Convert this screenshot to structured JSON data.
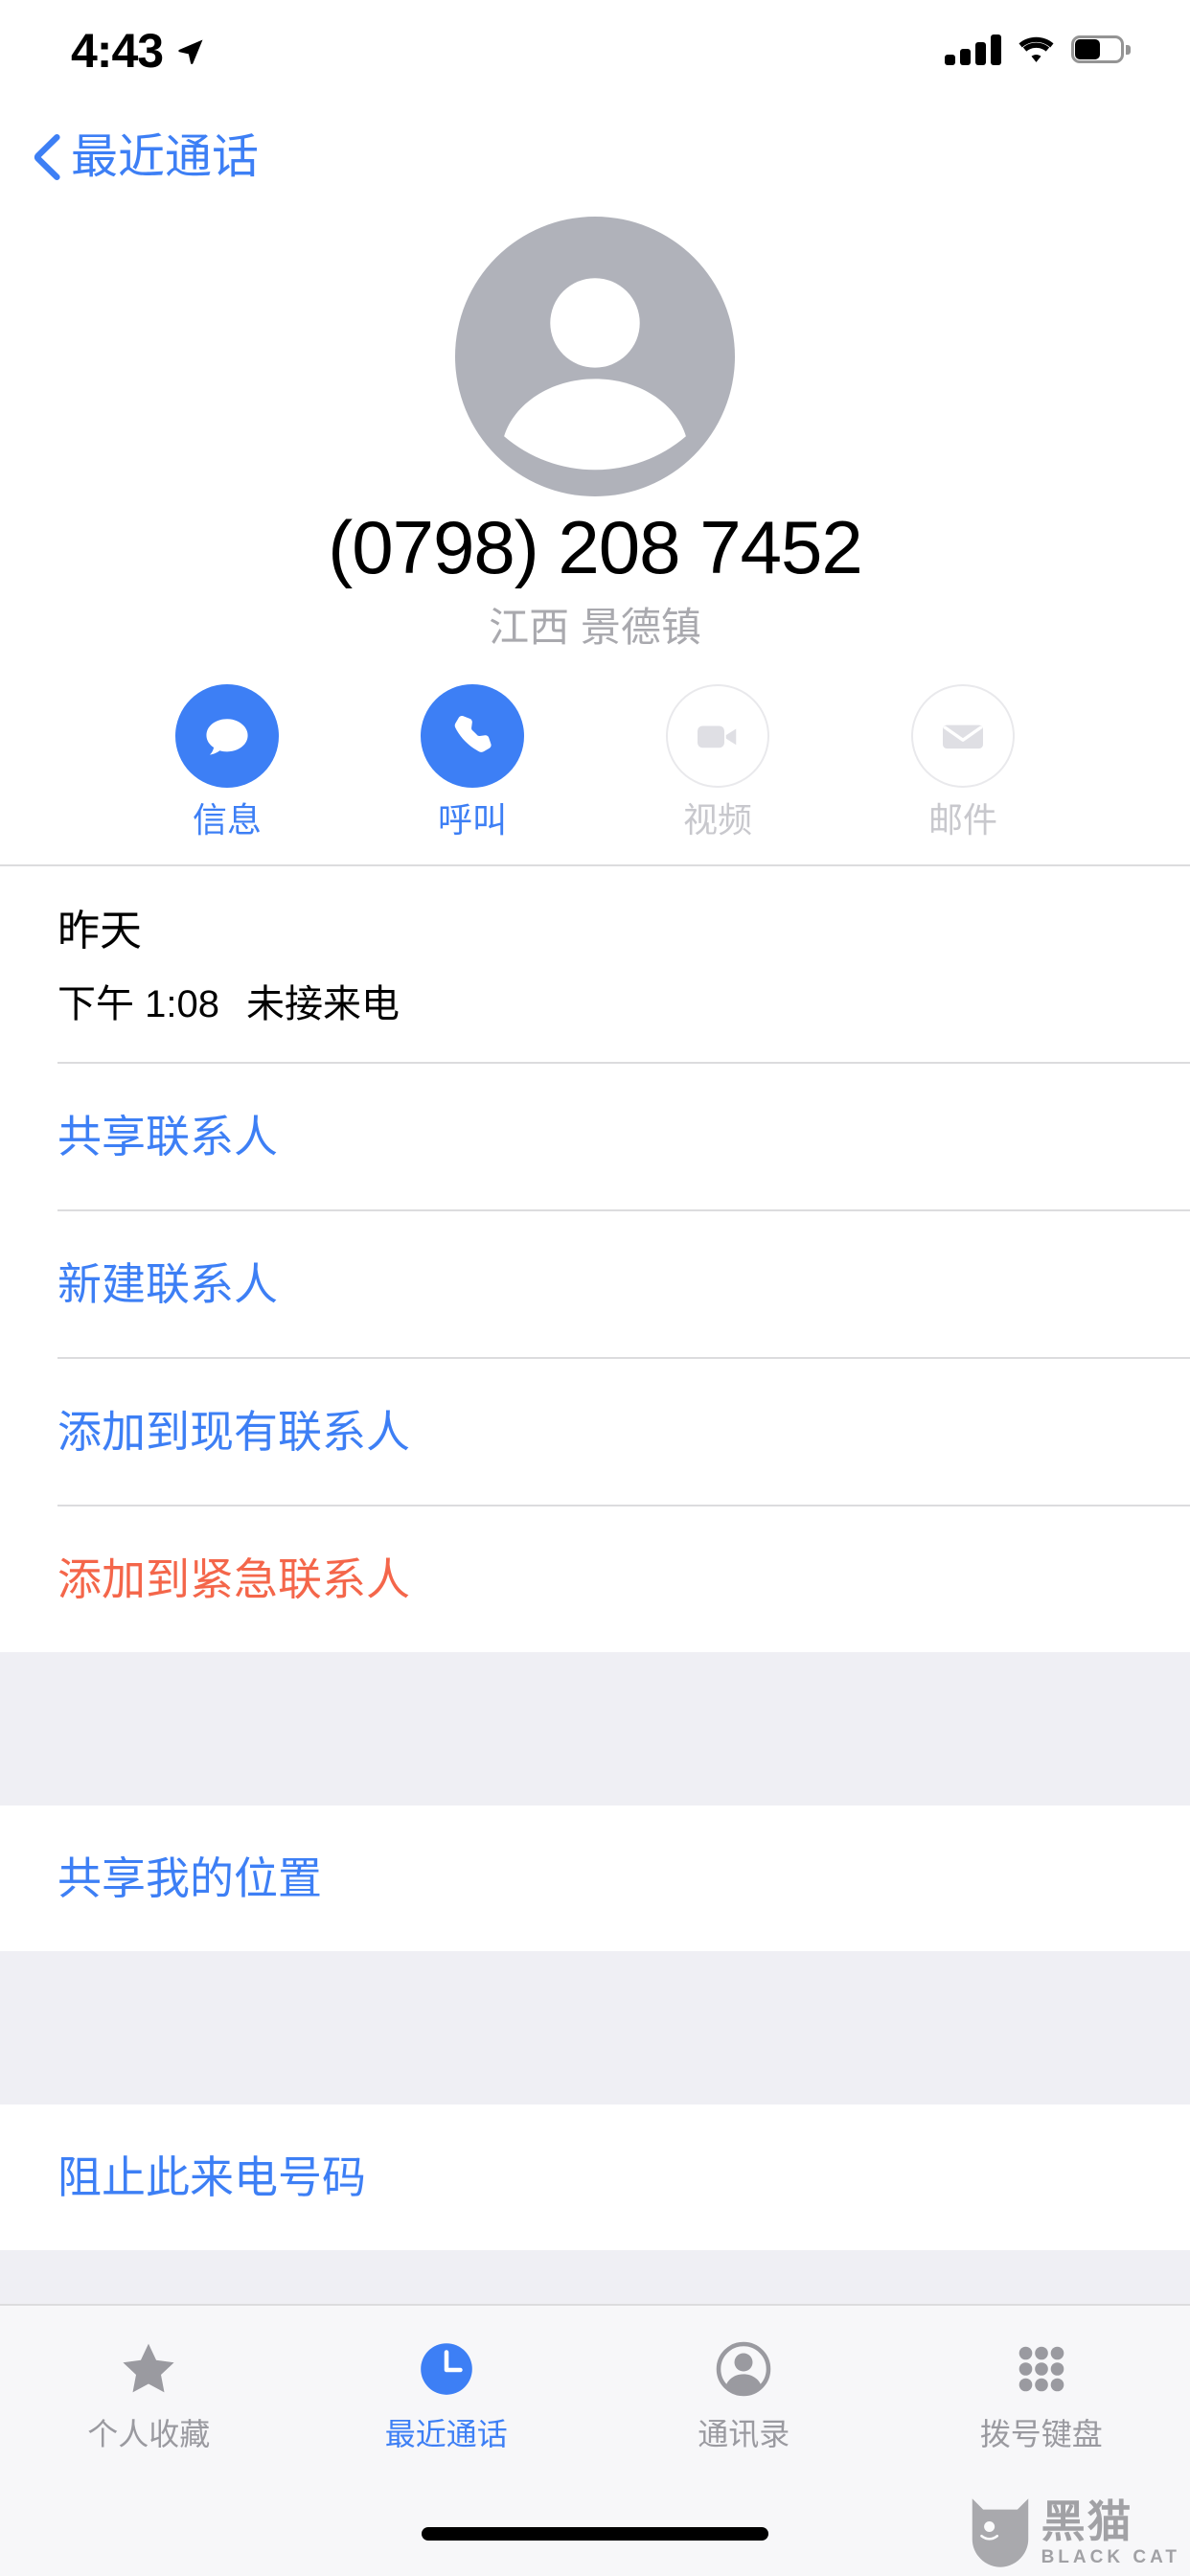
{
  "status_bar": {
    "time": "4:43",
    "location_arrow_icon": "location-arrow-icon",
    "signal_icon": "cellular-signal-icon",
    "signal_bars_filled": 4,
    "wifi_icon": "wifi-icon",
    "battery_icon": "battery-icon",
    "battery_level_percent": 55
  },
  "nav": {
    "back_label": "最近通话",
    "back_icon": "chevron-left-icon"
  },
  "contact": {
    "avatar_icon": "person-placeholder-avatar",
    "phone_number": "(0798) 208 7452",
    "locality": "江西 景德镇"
  },
  "actions": [
    {
      "label": "信息",
      "icon": "message-bubble-icon",
      "enabled": true
    },
    {
      "label": "呼叫",
      "icon": "phone-handset-icon",
      "enabled": true
    },
    {
      "label": "视频",
      "icon": "video-camera-icon",
      "enabled": false
    },
    {
      "label": "邮件",
      "icon": "mail-envelope-icon",
      "enabled": false
    }
  ],
  "call_log": {
    "day": "昨天",
    "time": "下午 1:08",
    "type": "未接来电"
  },
  "list_groups": [
    {
      "rows": [
        {
          "label": "共享联系人",
          "style": "link"
        },
        {
          "label": "新建联系人",
          "style": "link"
        },
        {
          "label": "添加到现有联系人",
          "style": "link"
        },
        {
          "label": "添加到紧急联系人",
          "style": "danger"
        }
      ]
    },
    {
      "rows": [
        {
          "label": "共享我的位置",
          "style": "link"
        }
      ]
    },
    {
      "rows": [
        {
          "label": "阻止此来电号码",
          "style": "link"
        }
      ]
    }
  ],
  "tabs": [
    {
      "label": "个人收藏",
      "icon": "star-icon",
      "active": false
    },
    {
      "label": "最近通话",
      "icon": "recents-clock-icon",
      "active": true
    },
    {
      "label": "通讯录",
      "icon": "contacts-person-icon",
      "active": false
    },
    {
      "label": "拨号键盘",
      "icon": "keypad-dots-icon",
      "active": false
    }
  ],
  "watermark": {
    "cn": "黑猫",
    "en": "BLACK CAT",
    "icon": "black-cat-logo-icon"
  },
  "colors": {
    "accent_blue": "#3d7ff5",
    "danger_red": "#f4664a",
    "disabled_gray": "#c8c8cd",
    "group_bg": "#efeff4",
    "separator": "#dcdcde",
    "avatar_gray": "#b0b2ba"
  }
}
